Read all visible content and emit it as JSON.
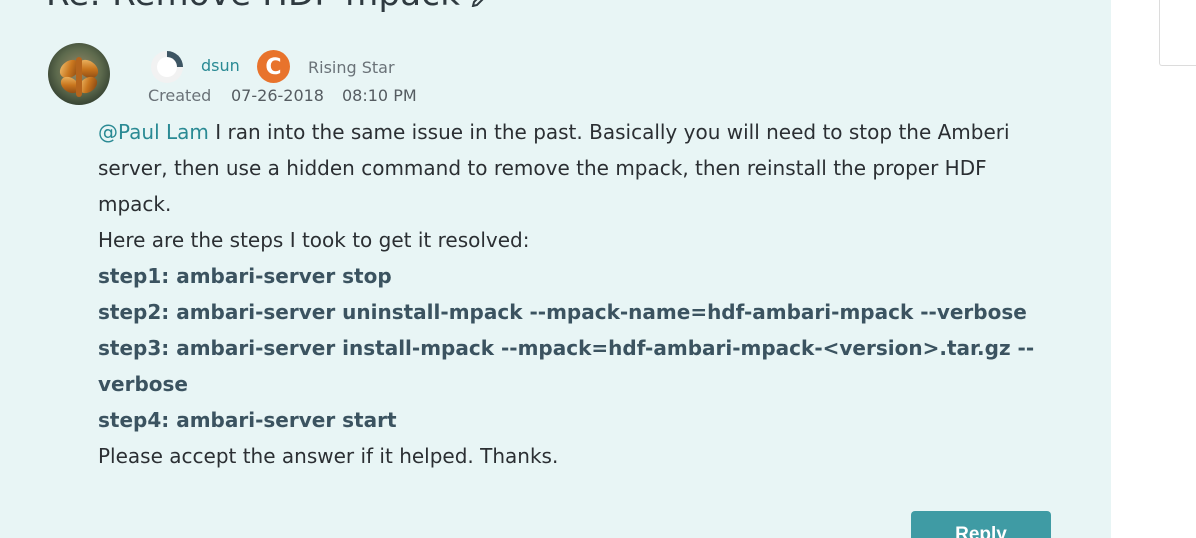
{
  "post": {
    "title": "Re: Remove HDF mpack",
    "author": {
      "username": "dsun",
      "rank": "Rising Star",
      "rank_badge_letter": "C"
    },
    "created_label": "Created",
    "created_date": "07-26-2018",
    "created_time": "08:10 PM",
    "body": {
      "mention": "@Paul Lam",
      "intro": " I ran into the same issue in the past. Basically you will need to stop the Amberi server, then use a hidden command to remove the mpack, then reinstall the proper HDF mpack.",
      "steps_intro": "Here are the steps I took to get it resolved:",
      "steps": [
        "step1: ambari-server stop",
        "step2: ambari-server uninstall-mpack --mpack-name=hdf-ambari-mpack --verbose",
        "step3: ambari-server install-mpack --mpack=hdf-ambari-mpack-<version>.tar.gz --verbose",
        "step4: ambari-server start"
      ],
      "closing": "Please accept the answer if it helped. Thanks."
    },
    "reply_label": "Reply"
  },
  "colors": {
    "card_background": "#e8f5f5",
    "accent": "#2a8a94",
    "button": "#3f9ba4",
    "rank_badge": "#e8732c"
  }
}
